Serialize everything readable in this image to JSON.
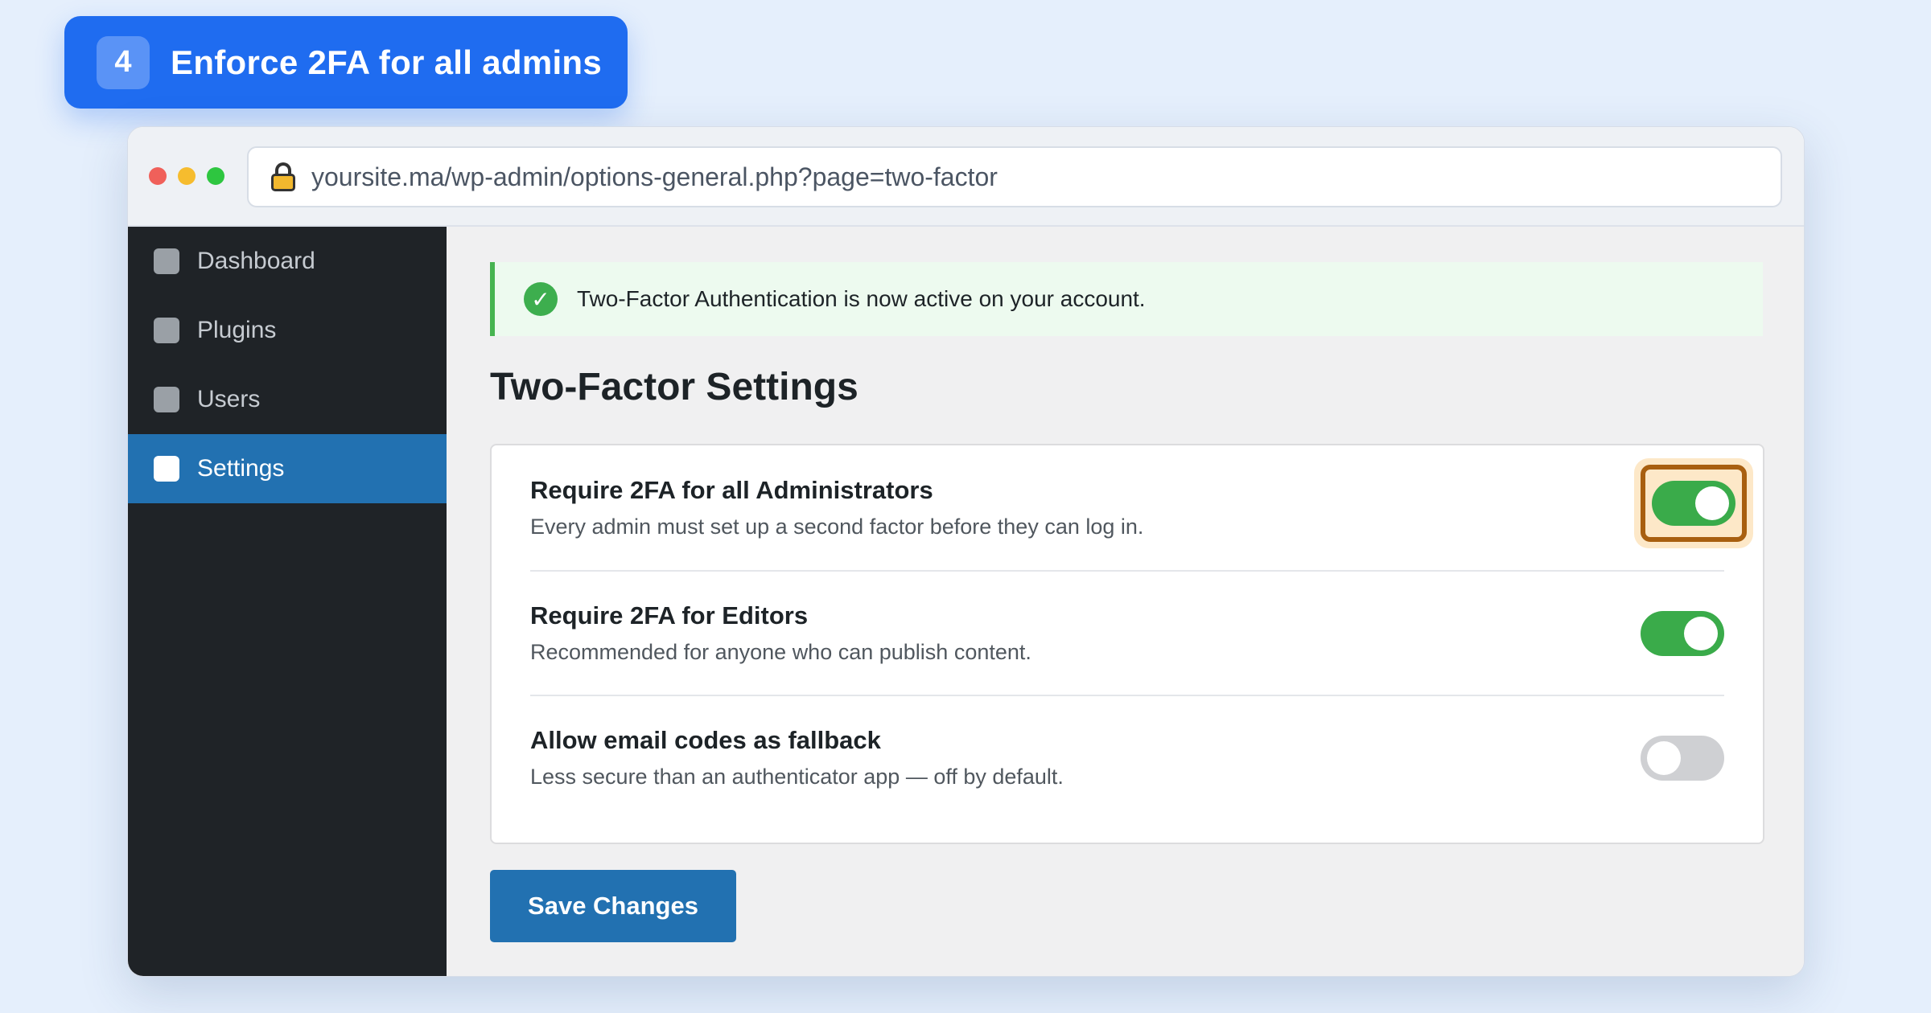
{
  "step": {
    "number": "4",
    "title": "Enforce 2FA for all admins"
  },
  "browser": {
    "url": "yoursite.ma/wp-admin/options-general.php?page=two-factor"
  },
  "sidebar": {
    "items": [
      {
        "label": "Dashboard",
        "active": false
      },
      {
        "label": "Plugins",
        "active": false
      },
      {
        "label": "Users",
        "active": false
      },
      {
        "label": "Settings",
        "active": true
      }
    ]
  },
  "notice": {
    "text": "Two-Factor Authentication is now active on your account."
  },
  "page": {
    "title": "Two-Factor Settings"
  },
  "settings": [
    {
      "title": "Require 2FA for all Administrators",
      "description": "Every admin must set up a second factor before they can log in.",
      "enabled": true,
      "highlighted": true
    },
    {
      "title": "Require 2FA for Editors",
      "description": "Recommended for anyone who can publish content.",
      "enabled": true,
      "highlighted": false
    },
    {
      "title": "Allow email codes as fallback",
      "description": "Less secure than an authenticator app — off by default.",
      "enabled": false,
      "highlighted": false
    }
  ],
  "save_label": "Save Changes",
  "colors": {
    "accent": "#1f6cf0",
    "wp_blue": "#2271b1",
    "success": "#46b450",
    "highlight": "#a85f10"
  }
}
